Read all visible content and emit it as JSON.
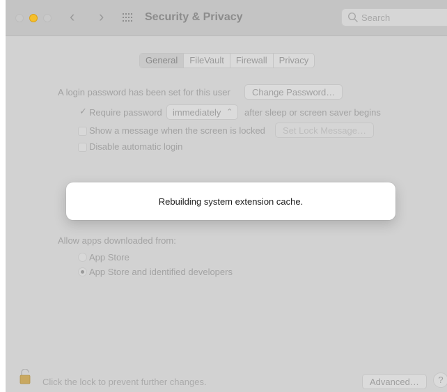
{
  "window": {
    "title": "Security & Privacy",
    "search_placeholder": "Search"
  },
  "tabs": [
    {
      "label": "General",
      "active": true
    },
    {
      "label": "FileVault",
      "active": false
    },
    {
      "label": "Firewall",
      "active": false
    },
    {
      "label": "Privacy",
      "active": false
    }
  ],
  "general": {
    "login_password_text": "A login password has been set for this user",
    "change_password_label": "Change Password…",
    "require_password_label": "Require password",
    "require_password_checked": true,
    "require_password_interval": "immediately",
    "after_sleep_text": "after sleep or screen saver begins",
    "show_message_label": "Show a message when the screen is locked",
    "show_message_checked": false,
    "set_lock_message_label": "Set Lock Message…",
    "disable_auto_login_label": "Disable automatic login",
    "disable_auto_login_checked": false
  },
  "allow_apps": {
    "heading": "Allow apps downloaded from:",
    "options": [
      {
        "label": "App Store",
        "selected": false
      },
      {
        "label": "App Store and identified developers",
        "selected": true
      }
    ]
  },
  "footer": {
    "lock_text": "Click the lock to prevent further changes.",
    "advanced_label": "Advanced…",
    "help_label": "?"
  },
  "toast": {
    "message": "Rebuilding system extension cache."
  },
  "colors": {
    "window_background": "#d2d2d2",
    "minimize_button": "#f5bf2c",
    "toast_background": "#ffffff"
  }
}
